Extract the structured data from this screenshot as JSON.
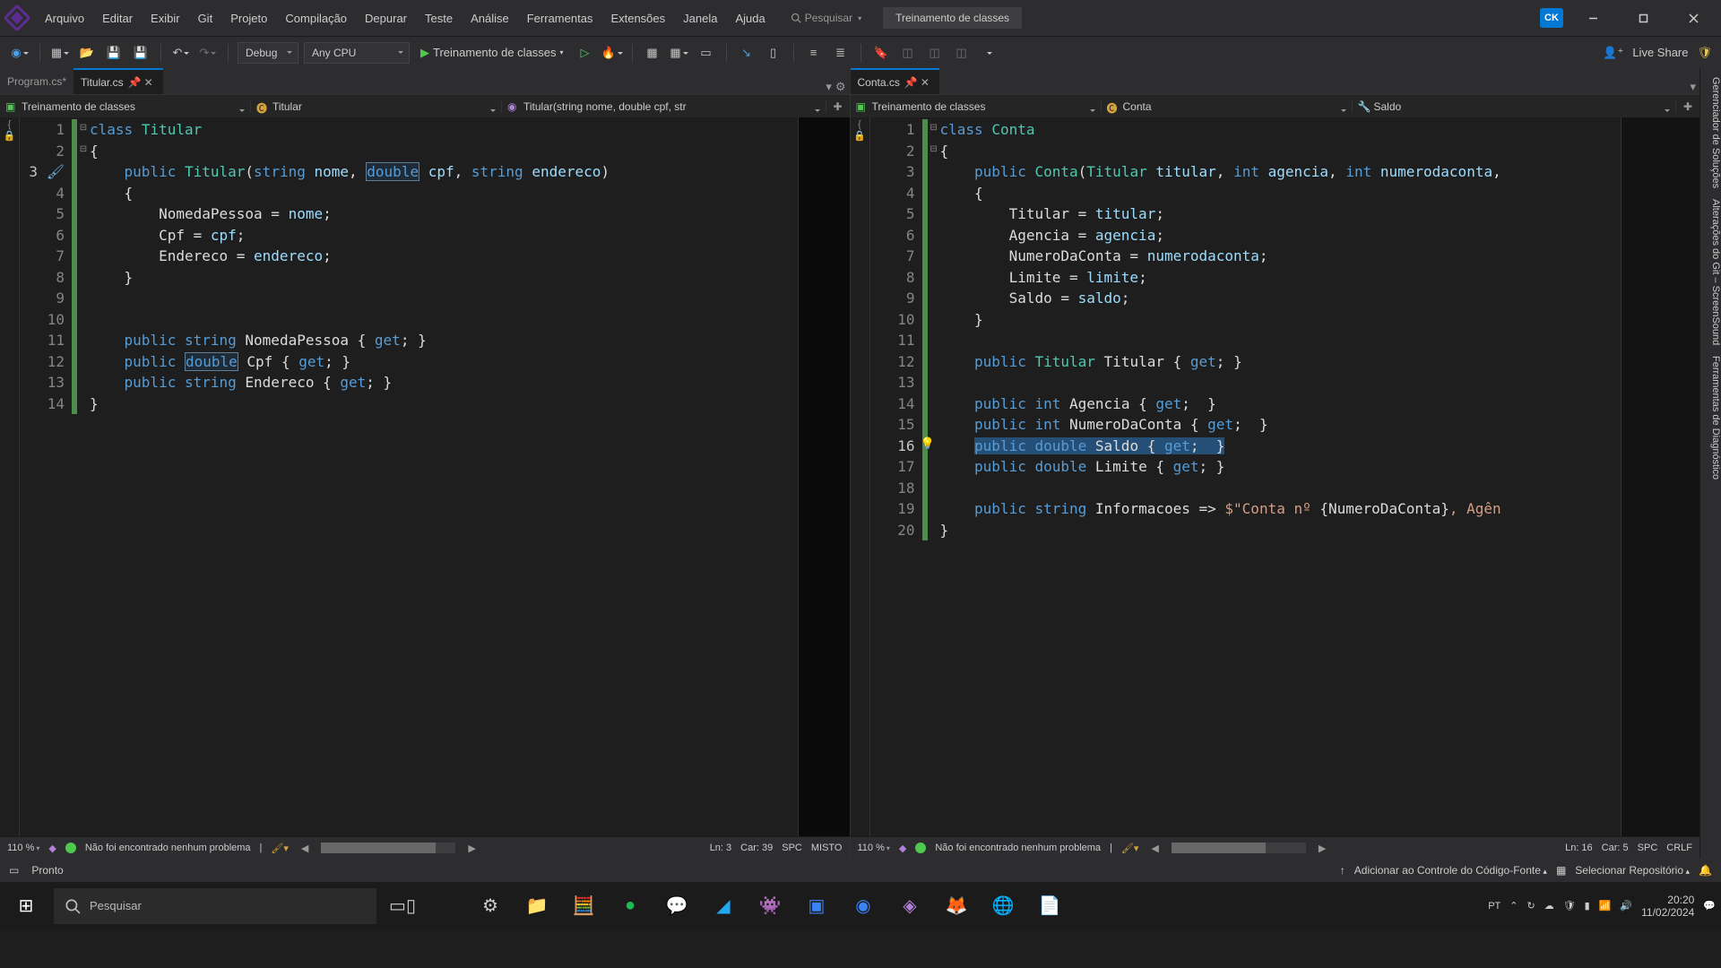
{
  "menu": [
    "Arquivo",
    "Editar",
    "Exibir",
    "Git",
    "Projeto",
    "Compilação",
    "Depurar",
    "Teste",
    "Análise",
    "Ferramentas",
    "Extensões",
    "Janela",
    "Ajuda"
  ],
  "search_placeholder": "Pesquisar",
  "project_name": "Treinamento de classes",
  "user_initials": "CK",
  "toolbar": {
    "config": "Debug",
    "platform": "Any CPU",
    "run_label": "Treinamento de classes",
    "live_share": "Live Share"
  },
  "side_tabs": [
    "Gerenciador de Soluções",
    "Alterações do Git – ScreenSound",
    "Ferramentas de Diagnóstico"
  ],
  "tabs_left": [
    {
      "label": "Program.cs*",
      "active": false
    },
    {
      "label": "Titular.cs",
      "active": true
    }
  ],
  "tabs_right": [
    {
      "label": "Conta.cs",
      "active": true
    }
  ],
  "crumbs_left": {
    "project": "Treinamento de classes",
    "class": "Titular",
    "member": "Titular(string nome, double cpf, str"
  },
  "crumbs_right": {
    "project": "Treinamento de classes",
    "class": "Conta",
    "member": "Saldo"
  },
  "code_left": {
    "lines": 14,
    "current_line": 3
  },
  "code_right": {
    "lines": 20,
    "current_line": 16
  },
  "ed_status_left": {
    "zoom": "110 %",
    "problems": "Não foi encontrado nenhum problema",
    "ln": "Ln: 3",
    "car": "Car: 39",
    "ind": "SPC",
    "eol": "MISTO"
  },
  "ed_status_right": {
    "zoom": "110 %",
    "problems": "Não foi encontrado nenhum problema",
    "ln": "Ln: 16",
    "car": "Car: 5",
    "ind": "SPC",
    "eol": "CRLF"
  },
  "ide_status": {
    "ready": "Pronto",
    "src": "Adicionar ao Controle do Código-Fonte",
    "repo": "Selecionar Repositório"
  },
  "taskbar": {
    "search": "Pesquisar",
    "lang": "PT",
    "time": "20:20",
    "date": "11/02/2024"
  }
}
